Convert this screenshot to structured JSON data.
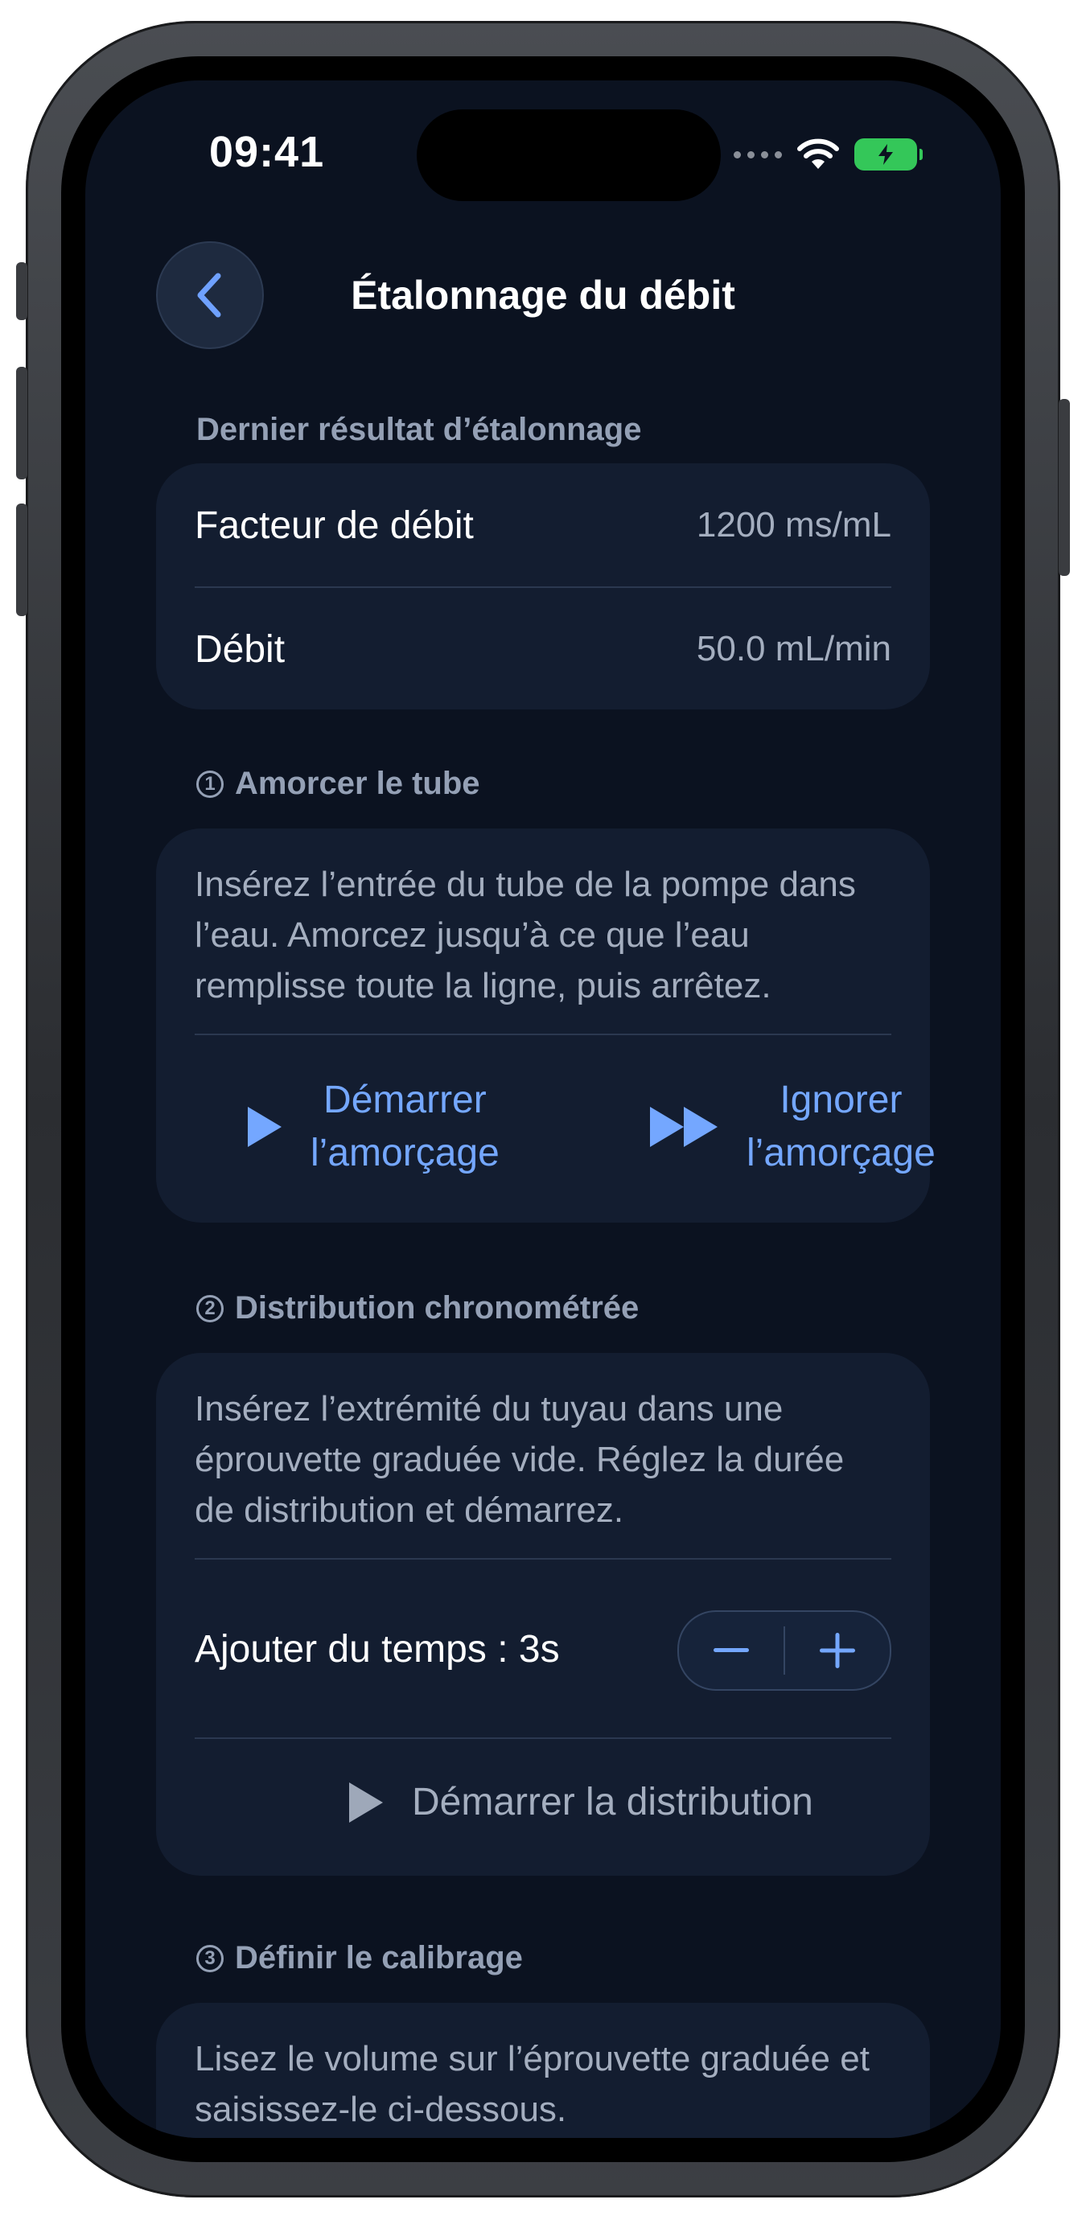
{
  "status_bar": {
    "time": "09:41"
  },
  "nav": {
    "title": "Étalonnage du débit"
  },
  "last_result": {
    "section_label": "Dernier résultat d’étalonnage",
    "rows": [
      {
        "label": "Facteur de débit",
        "value": "1200 ms/mL"
      },
      {
        "label": "Débit",
        "value": "50.0 mL/min"
      }
    ]
  },
  "step1": {
    "number": "1",
    "label": "Amorcer le tube",
    "description": "Insérez l’entrée du tube de la pompe dans l’eau. Amorcez jusqu’à ce que l’eau remplisse toute la ligne, puis arrêtez.",
    "start_priming_line1": "Démarrer",
    "start_priming_line2": "l’amorçage",
    "skip_priming_line1": "Ignorer",
    "skip_priming_line2": "l’amorçage",
    "accent_color": "#74a7ff"
  },
  "step2": {
    "number": "2",
    "label": "Distribution chronométrée",
    "description": "Insérez l’extrémité du tuyau dans une éprouvette graduée vide. Réglez la durée de distribution et démarrez.",
    "add_time_label": "Ajouter du temps : 3s",
    "start_dispense_label": "Démarrer la distribution"
  },
  "step3": {
    "number": "3",
    "label": "Définir le calibrage",
    "description": "Lisez le volume sur l’éprouvette graduée et saisissez-le ci-dessous."
  }
}
